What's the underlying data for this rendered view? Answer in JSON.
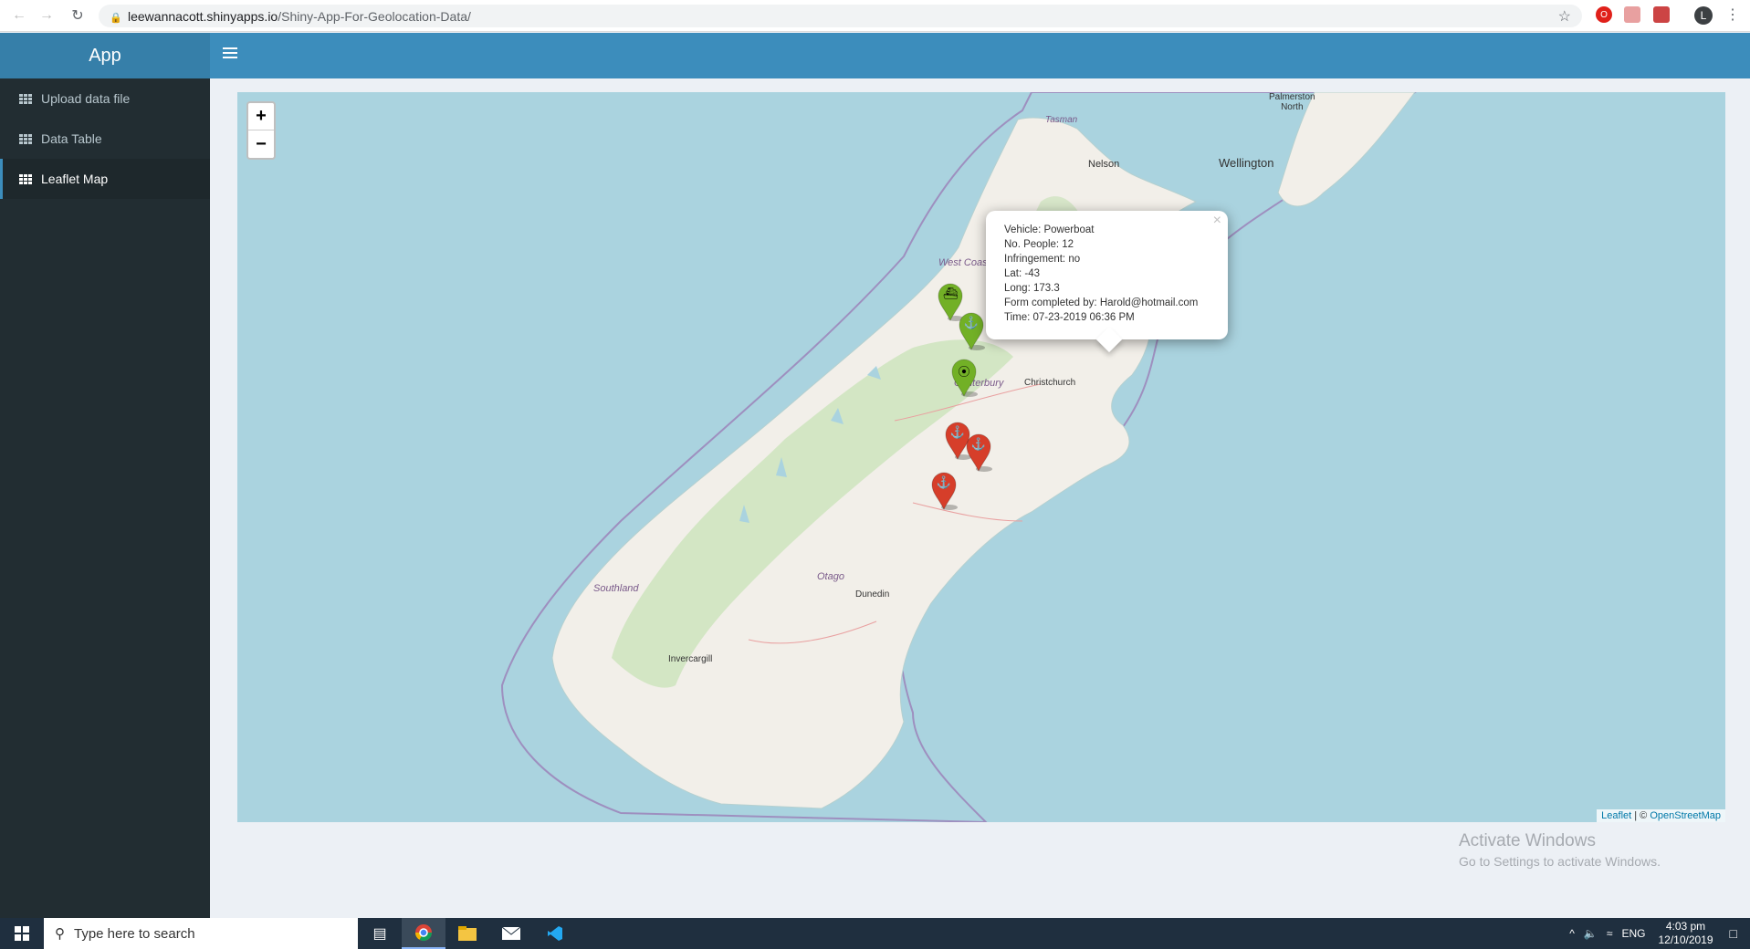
{
  "browser": {
    "url_host": "leewannacott.shinyapps.io",
    "url_path": "/Shiny-App-For-Geolocation-Data/",
    "avatar_letter": "L"
  },
  "app": {
    "title": "App",
    "header_color": "#3c8dbc",
    "logo_color": "#367fa9",
    "sidebar_color": "#222d32"
  },
  "sidebar": {
    "items": [
      {
        "label": "Upload data file",
        "icon": "table-icon",
        "active": false
      },
      {
        "label": "Data Table",
        "icon": "table-icon",
        "active": false
      },
      {
        "label": "Leaflet Map",
        "icon": "table-icon",
        "active": true
      }
    ]
  },
  "map": {
    "zoom_in": "+",
    "zoom_out": "−",
    "places": {
      "palmerston": "Palmerston\nNorth",
      "wellington": "Wellington",
      "nelson": "Nelson",
      "christchurch": "Christchurch",
      "dunedin": "Dunedin",
      "invercargill": "Invercargill"
    },
    "regions": {
      "tasman": "Tasman",
      "west_coast": "West Coas",
      "canterbury": "Canterbury",
      "otago": "Otago",
      "southland": "Southland"
    },
    "markers": [
      {
        "name": "marker-powerboat",
        "color": "#72b026",
        "icon": "ship-icon",
        "glyph": "⛴"
      },
      {
        "name": "marker-anchor-green",
        "color": "#72b026",
        "icon": "anchor-icon",
        "glyph": "⚓"
      },
      {
        "name": "marker-compass-green",
        "color": "#72b026",
        "icon": "compass-icon",
        "glyph": "⦿"
      },
      {
        "name": "marker-anchor-red-1",
        "color": "#d63e2a",
        "icon": "anchor-icon",
        "glyph": "⚓"
      },
      {
        "name": "marker-anchor-red-2",
        "color": "#d63e2a",
        "icon": "anchor-icon",
        "glyph": "⚓"
      },
      {
        "name": "marker-anchor-red-3",
        "color": "#d63e2a",
        "icon": "anchor-icon",
        "glyph": "⚓"
      }
    ],
    "popup": {
      "vehicle": "Vehicle: Powerboat",
      "people": "No. People: 12",
      "infringement": "Infringement: no",
      "lat": "Lat: -43",
      "long": "Long: 173.3",
      "completed_by": "Form completed by: Harold@hotmail.com",
      "time": "Time: 07-23-2019 06:36 PM",
      "close": "×"
    },
    "attribution": {
      "leaflet": "Leaflet",
      "separator": " | © ",
      "osm": "OpenStreetMap"
    }
  },
  "watermark": {
    "line1": "Activate Windows",
    "line2": "Go to Settings to activate Windows."
  },
  "taskbar": {
    "search_placeholder": "Type here to search",
    "lang": "ENG",
    "time": "4:03 pm",
    "date": "12/10/2019"
  }
}
